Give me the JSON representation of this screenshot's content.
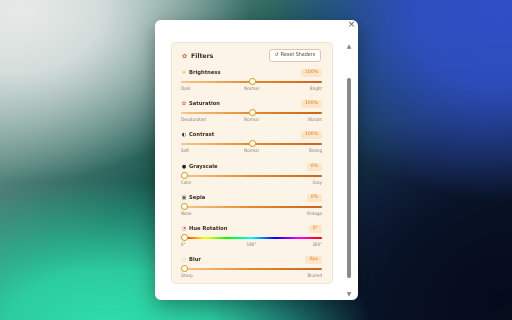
{
  "window": {
    "close_icon": "×"
  },
  "panel": {
    "title": "Filters",
    "title_icon": "palette-icon",
    "reset_label": "Reset Shaders",
    "reset_icon": "↺"
  },
  "filters": [
    {
      "name": "Brightness",
      "icon": "sun-icon",
      "glyph": "☀",
      "glyph_color": "#e5a022",
      "value_text": "100%",
      "value": 0.5,
      "ticks": [
        "Dark",
        "Normal",
        "Bright"
      ],
      "track": "warm"
    },
    {
      "name": "Saturation",
      "icon": "palette-icon",
      "glyph": "✿",
      "glyph_color": "#c85a3c",
      "value_text": "100%",
      "value": 0.5,
      "ticks": [
        "Desaturated",
        "Normal",
        "Vibrant"
      ],
      "track": "warm"
    },
    {
      "name": "Contrast",
      "icon": "contrast-icon",
      "glyph": "◐",
      "glyph_color": "#333333",
      "value_text": "100%",
      "value": 0.5,
      "ticks": [
        "Soft",
        "Normal",
        "Strong"
      ],
      "track": "warm"
    },
    {
      "name": "Grayscale",
      "icon": "circle-icon",
      "glyph": "●",
      "glyph_color": "#222222",
      "value_text": "0%",
      "value": 0.0,
      "ticks": [
        "Color",
        "",
        "Gray"
      ],
      "track": "warm"
    },
    {
      "name": "Sepia",
      "icon": "camera-icon",
      "glyph": "▣",
      "glyph_color": "#555555",
      "value_text": "0%",
      "value": 0.0,
      "ticks": [
        "None",
        "",
        "Vintage"
      ],
      "track": "warm"
    },
    {
      "name": "Hue Rotation",
      "icon": "rainbow-icon",
      "glyph": "◔",
      "glyph_color": "#d04a6a",
      "value_text": "0°",
      "value": 0.0,
      "ticks": [
        "0°",
        "180°",
        "360°"
      ],
      "track": "hue"
    },
    {
      "name": "Blur",
      "icon": "droplet-icon",
      "glyph": "◌",
      "glyph_color": "#7a8aa8",
      "value_text": "0px",
      "value": 0.0,
      "ticks": [
        "Sharp",
        "",
        "Blurred"
      ],
      "track": "warm"
    }
  ],
  "scrollbar": {
    "up_icon": "▲",
    "down_icon": "▼"
  }
}
